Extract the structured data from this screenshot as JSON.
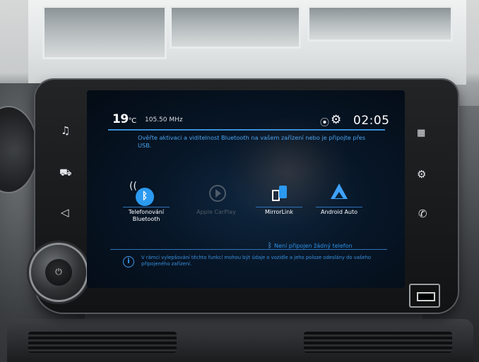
{
  "status_bar": {
    "temperature": "19",
    "temperature_unit": "°C",
    "frequency": "105.50 MHz",
    "clock": "02:05",
    "icons": [
      "location-icon",
      "gear-icon"
    ]
  },
  "notice": "Ověřte aktivaci a viditelnost Bluetooth na vašem zařízení nebo je připojte přes USB.",
  "apps": [
    {
      "label": "Telefonování Bluetooth",
      "icon": "bluetooth-phone-icon",
      "enabled": true
    },
    {
      "label": "Apple CarPlay",
      "icon": "carplay-icon",
      "enabled": false
    },
    {
      "label": "MirrorLink",
      "icon": "mirrorlink-icon",
      "enabled": true
    },
    {
      "label": "Android Auto",
      "icon": "android-auto-icon",
      "enabled": true
    }
  ],
  "connection_status": "Není připojen žádný telefon",
  "info": "V rámci vylepšování těchto funkcí mohou být údaje o vozidle a jeho poloze odeslány do vašeho připojeného zařízení.",
  "side_buttons": {
    "left": [
      "music-icon",
      "car-icon",
      "navigation-icon"
    ],
    "right": [
      "apps-grid-icon",
      "settings-icon",
      "phone-icon"
    ]
  },
  "colors": {
    "accent": "#2b9af0",
    "screen_bg": "#071627",
    "disabled": "#4e5b69"
  }
}
